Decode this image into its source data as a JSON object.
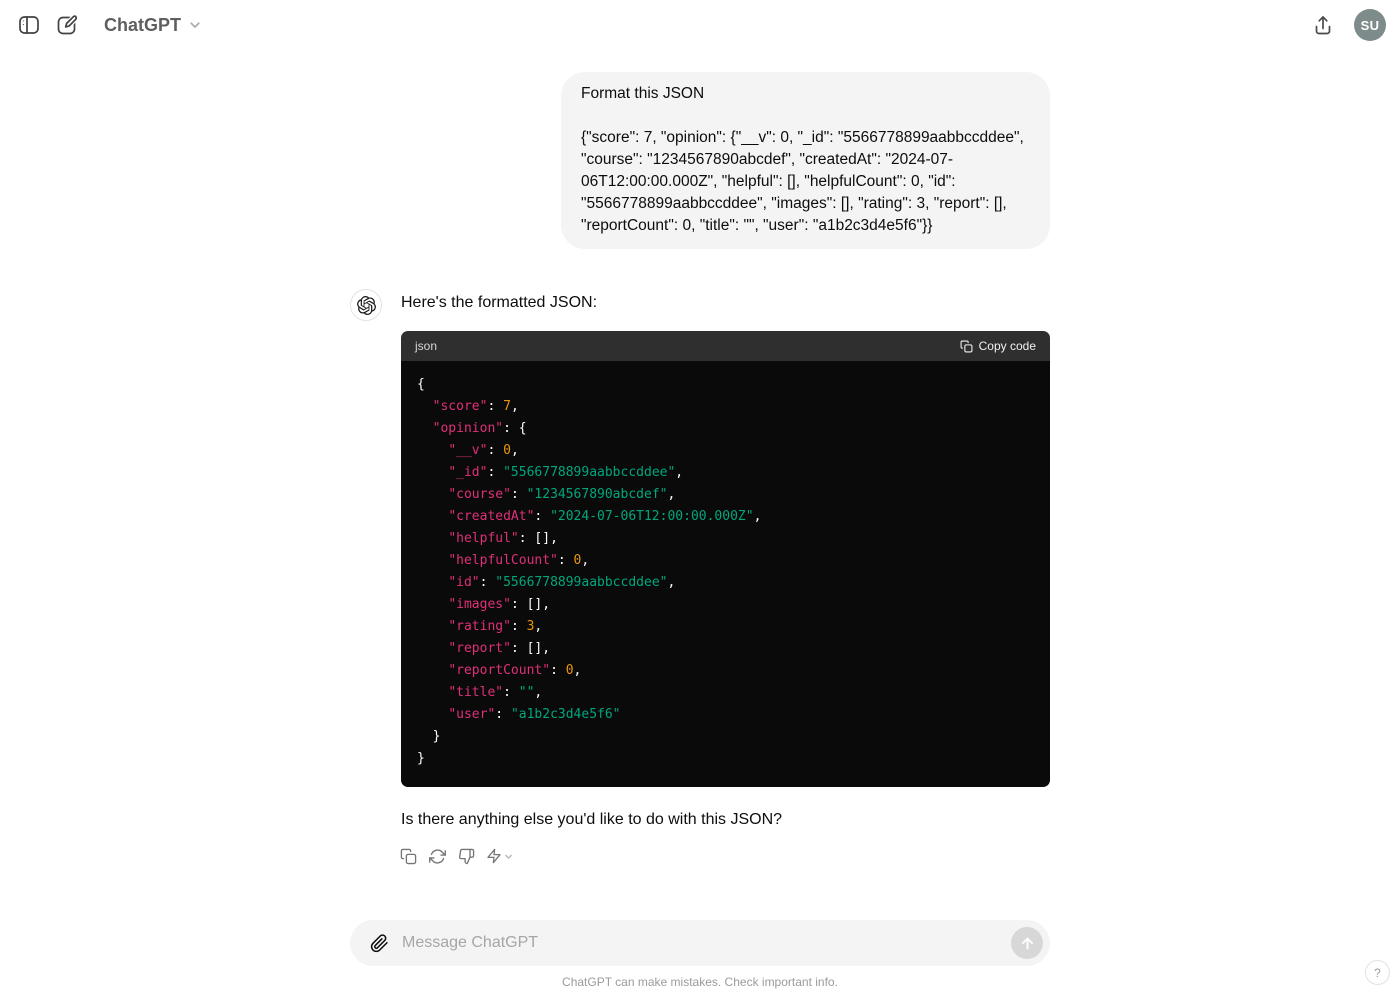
{
  "header": {
    "app_title": "ChatGPT",
    "avatar_initials": "SU"
  },
  "user_message": {
    "line1": "Format this JSON",
    "line2": "{\"score\": 7, \"opinion\": {\"__v\": 0, \"_id\": \"5566778899aabbccddee\", \"course\": \"1234567890abcdef\", \"createdAt\": \"2024-07-06T12:00:00.000Z\", \"helpful\": [], \"helpfulCount\": 0, \"id\": \"5566778899aabbccddee\", \"images\": [], \"rating\": 3, \"report\": [], \"reportCount\": 0, \"title\": \"\", \"user\": \"a1b2c3d4e5f6\"}}"
  },
  "assistant": {
    "intro": "Here's the formatted JSON:",
    "code_language": "json",
    "copy_code_label": "Copy code",
    "outro": "Is there anything else you'd like to do with this JSON?",
    "code_lines": [
      [
        {
          "t": "{",
          "c": "pun"
        }
      ],
      [
        {
          "t": "  ",
          "c": "pun"
        },
        {
          "t": "\"score\"",
          "c": "key"
        },
        {
          "t": ": ",
          "c": "pun"
        },
        {
          "t": "7",
          "c": "num"
        },
        {
          "t": ",",
          "c": "pun"
        }
      ],
      [
        {
          "t": "  ",
          "c": "pun"
        },
        {
          "t": "\"opinion\"",
          "c": "key"
        },
        {
          "t": ": {",
          "c": "pun"
        }
      ],
      [
        {
          "t": "    ",
          "c": "pun"
        },
        {
          "t": "\"__v\"",
          "c": "key"
        },
        {
          "t": ": ",
          "c": "pun"
        },
        {
          "t": "0",
          "c": "num"
        },
        {
          "t": ",",
          "c": "pun"
        }
      ],
      [
        {
          "t": "    ",
          "c": "pun"
        },
        {
          "t": "\"_id\"",
          "c": "key"
        },
        {
          "t": ": ",
          "c": "pun"
        },
        {
          "t": "\"5566778899aabbccddee\"",
          "c": "str"
        },
        {
          "t": ",",
          "c": "pun"
        }
      ],
      [
        {
          "t": "    ",
          "c": "pun"
        },
        {
          "t": "\"course\"",
          "c": "key"
        },
        {
          "t": ": ",
          "c": "pun"
        },
        {
          "t": "\"1234567890abcdef\"",
          "c": "str"
        },
        {
          "t": ",",
          "c": "pun"
        }
      ],
      [
        {
          "t": "    ",
          "c": "pun"
        },
        {
          "t": "\"createdAt\"",
          "c": "key"
        },
        {
          "t": ": ",
          "c": "pun"
        },
        {
          "t": "\"2024-07-06T12:00:00.000Z\"",
          "c": "str"
        },
        {
          "t": ",",
          "c": "pun"
        }
      ],
      [
        {
          "t": "    ",
          "c": "pun"
        },
        {
          "t": "\"helpful\"",
          "c": "key"
        },
        {
          "t": ": [],",
          "c": "pun"
        }
      ],
      [
        {
          "t": "    ",
          "c": "pun"
        },
        {
          "t": "\"helpfulCount\"",
          "c": "key"
        },
        {
          "t": ": ",
          "c": "pun"
        },
        {
          "t": "0",
          "c": "num"
        },
        {
          "t": ",",
          "c": "pun"
        }
      ],
      [
        {
          "t": "    ",
          "c": "pun"
        },
        {
          "t": "\"id\"",
          "c": "key"
        },
        {
          "t": ": ",
          "c": "pun"
        },
        {
          "t": "\"5566778899aabbccddee\"",
          "c": "str"
        },
        {
          "t": ",",
          "c": "pun"
        }
      ],
      [
        {
          "t": "    ",
          "c": "pun"
        },
        {
          "t": "\"images\"",
          "c": "key"
        },
        {
          "t": ": [],",
          "c": "pun"
        }
      ],
      [
        {
          "t": "    ",
          "c": "pun"
        },
        {
          "t": "\"rating\"",
          "c": "key"
        },
        {
          "t": ": ",
          "c": "pun"
        },
        {
          "t": "3",
          "c": "num"
        },
        {
          "t": ",",
          "c": "pun"
        }
      ],
      [
        {
          "t": "    ",
          "c": "pun"
        },
        {
          "t": "\"report\"",
          "c": "key"
        },
        {
          "t": ": [],",
          "c": "pun"
        }
      ],
      [
        {
          "t": "    ",
          "c": "pun"
        },
        {
          "t": "\"reportCount\"",
          "c": "key"
        },
        {
          "t": ": ",
          "c": "pun"
        },
        {
          "t": "0",
          "c": "num"
        },
        {
          "t": ",",
          "c": "pun"
        }
      ],
      [
        {
          "t": "    ",
          "c": "pun"
        },
        {
          "t": "\"title\"",
          "c": "key"
        },
        {
          "t": ": ",
          "c": "pun"
        },
        {
          "t": "\"\"",
          "c": "str"
        },
        {
          "t": ",",
          "c": "pun"
        }
      ],
      [
        {
          "t": "    ",
          "c": "pun"
        },
        {
          "t": "\"user\"",
          "c": "key"
        },
        {
          "t": ": ",
          "c": "pun"
        },
        {
          "t": "\"a1b2c3d4e5f6\"",
          "c": "str"
        }
      ],
      [
        {
          "t": "  }",
          "c": "pun"
        }
      ],
      [
        {
          "t": "}",
          "c": "pun"
        }
      ]
    ]
  },
  "composer": {
    "placeholder": "Message ChatGPT"
  },
  "footer": {
    "disclaimer": "ChatGPT can make mistakes. Check important info.",
    "help_label": "?"
  },
  "colors": {
    "code_key": "#df3079",
    "code_string": "#00a67d",
    "code_number": "#e9950c",
    "code_punctuation": "#ffffff",
    "code_bg": "#0a0a0a",
    "code_header_bg": "#2f2f2f",
    "user_bubble_bg": "#f4f4f4",
    "user_avatar_bg": "#7d8c8a",
    "send_button_bg": "#d7d7d7"
  }
}
